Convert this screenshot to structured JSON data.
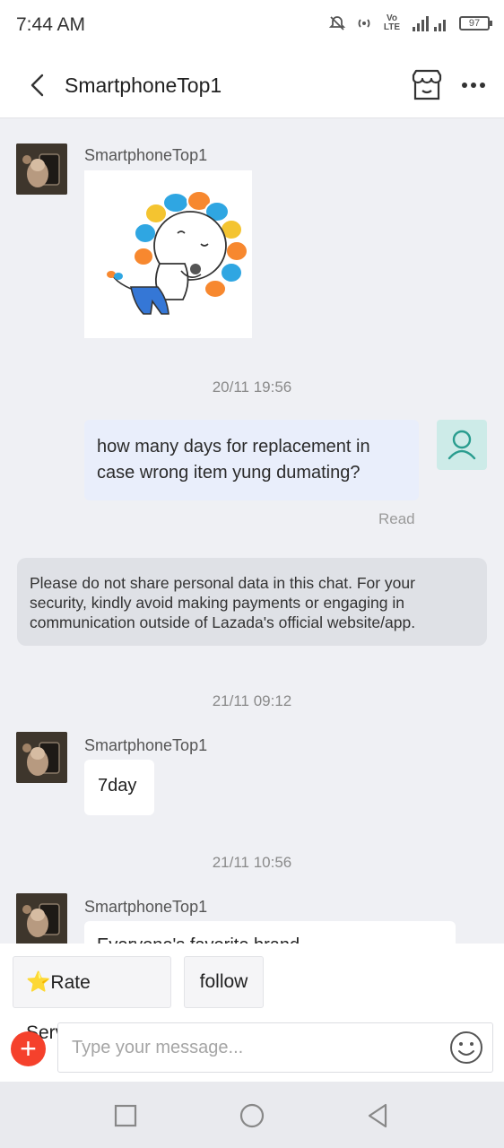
{
  "status_bar": {
    "time": "7:44 AM",
    "battery": "97",
    "volte": "Vo LTE",
    "network": "4G"
  },
  "header": {
    "title": "SmartphoneTop1"
  },
  "messages": {
    "first": {
      "sender": "SmartphoneTop1"
    },
    "ts1": "20/11 19:56",
    "outgoing": {
      "text": "how many days for replacement in case wrong item yung dumating?",
      "status": "Read"
    },
    "notice": "Please do not share personal data in this chat. For your security, kindly avoid making payments or engaging in communication outside of Lazada's official website/app.",
    "ts2": "21/11 09:12",
    "second": {
      "sender": "SmartphoneTop1",
      "text": "7day"
    },
    "ts3": "21/11 10:56",
    "third": {
      "sender": "SmartphoneTop1",
      "text": "Everyone's favorite brand"
    }
  },
  "quick_replies": {
    "rate": "Rate Service",
    "rate_icon": "⭐",
    "follow": "follow"
  },
  "composer": {
    "placeholder": "Type your message...",
    "plus": "+"
  },
  "colors": {
    "accent": "#f5412c",
    "outgoing_bg": "#e9eefb",
    "user_avatar_bg": "#cdebe8",
    "teal": "#2a9d8f"
  }
}
